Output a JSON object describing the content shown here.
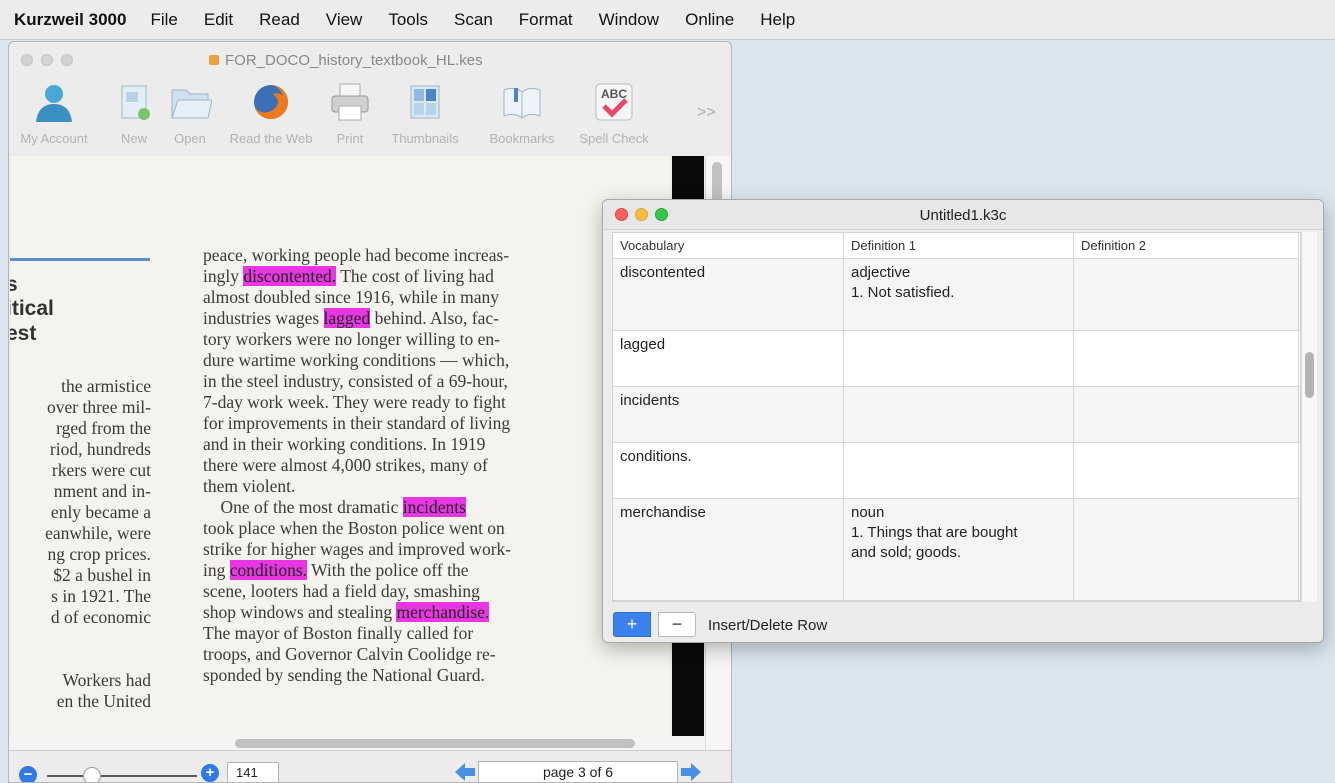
{
  "menubar": {
    "app_name": "Kurzweil 3000",
    "items": [
      "File",
      "Edit",
      "Read",
      "View",
      "Tools",
      "Scan",
      "Format",
      "Window",
      "Online",
      "Help"
    ]
  },
  "doc_window": {
    "title": "FOR_DOCO_history_textbook_HL.kes",
    "toolbar": [
      {
        "label": "My Account",
        "icon": "user-icon"
      },
      {
        "label": "New",
        "icon": "new-document-icon"
      },
      {
        "label": "Open",
        "icon": "folder-icon"
      },
      {
        "label": "Read the Web",
        "icon": "firefox-icon"
      },
      {
        "label": "Print",
        "icon": "printer-icon"
      },
      {
        "label": "Thumbnails",
        "icon": "thumbnails-icon"
      },
      {
        "label": "Bookmarks",
        "icon": "bookmarks-icon"
      },
      {
        "label": "Spell Check",
        "icon": "spell-check-icon"
      }
    ],
    "toolbar_overflow": ">>",
    "page_text": {
      "left_heading": [
        "s",
        "itical",
        "est"
      ],
      "left_lines": [
        "the armistice",
        "over three mil-",
        "rged from the",
        "riod, hundreds",
        "rkers were cut",
        "nment and in-",
        "enly became a",
        "eanwhile, were",
        "ng crop prices.",
        "$2 a bushel in",
        "s in 1921. The",
        "d of economic",
        "",
        "",
        "Workers had",
        "en the United"
      ],
      "right_lines": [
        [
          "peace, working people had become increas-"
        ],
        [
          "ingly ",
          {
            "hl": "discontented."
          },
          " The cost of living had"
        ],
        [
          "almost doubled since 1916, while in many"
        ],
        [
          "industries wages ",
          {
            "hl": "lagged"
          },
          " behind. Also, fac-"
        ],
        [
          "tory workers were no longer willing to en-"
        ],
        [
          "dure wartime working conditions — which,"
        ],
        [
          "in the steel industry, consisted of a 69-hour,"
        ],
        [
          "7-day work week. They were ready to fight"
        ],
        [
          "for improvements in their standard of living"
        ],
        [
          "and in their working conditions. In 1919"
        ],
        [
          "there were almost 4,000 strikes, many of"
        ],
        [
          "them violent."
        ],
        [
          "    One of the most dramatic ",
          {
            "hl": "incidents"
          }
        ],
        [
          "took place when the Boston police went on"
        ],
        [
          "strike for higher wages and improved work-"
        ],
        [
          "ing ",
          {
            "hl": "conditions."
          },
          " With the police off the"
        ],
        [
          "scene, looters had a field day, smashing"
        ],
        [
          "shop windows and stealing ",
          {
            "hl": "merchandise."
          }
        ],
        [
          "The mayor of Boston finally called for"
        ],
        [
          "troops, and Governor Calvin Coolidge re-"
        ],
        [
          "sponded by sending the National Guard."
        ]
      ]
    },
    "zoom_value": "141",
    "page_indicator": "page 3 of 6"
  },
  "vocab_window": {
    "title": "Untitled1.k3c",
    "columns": [
      "Vocabulary",
      "Definition 1",
      "Definition 2"
    ],
    "rows": [
      {
        "vocab": "discontented",
        "def1": [
          "adjective",
          "1. Not satisfied."
        ],
        "def2": ""
      },
      {
        "vocab": "lagged",
        "def1": [],
        "def2": ""
      },
      {
        "vocab": "incidents",
        "def1": [],
        "def2": ""
      },
      {
        "vocab": "conditions.",
        "def1": [],
        "def2": ""
      },
      {
        "vocab": "merchandise",
        "def1": [
          "noun",
          "1. Things that are bought",
          "and sold; goods."
        ],
        "def2": ""
      }
    ],
    "insert_delete_label": "Insert/Delete Row",
    "plus_label": "+",
    "minus_label": "−"
  },
  "colors": {
    "highlight": "#e836e3",
    "accent_blue": "#3b82f0",
    "close_red": "#fc605b",
    "minimize_yellow": "#fdbc40",
    "zoom_green": "#34c84a"
  }
}
